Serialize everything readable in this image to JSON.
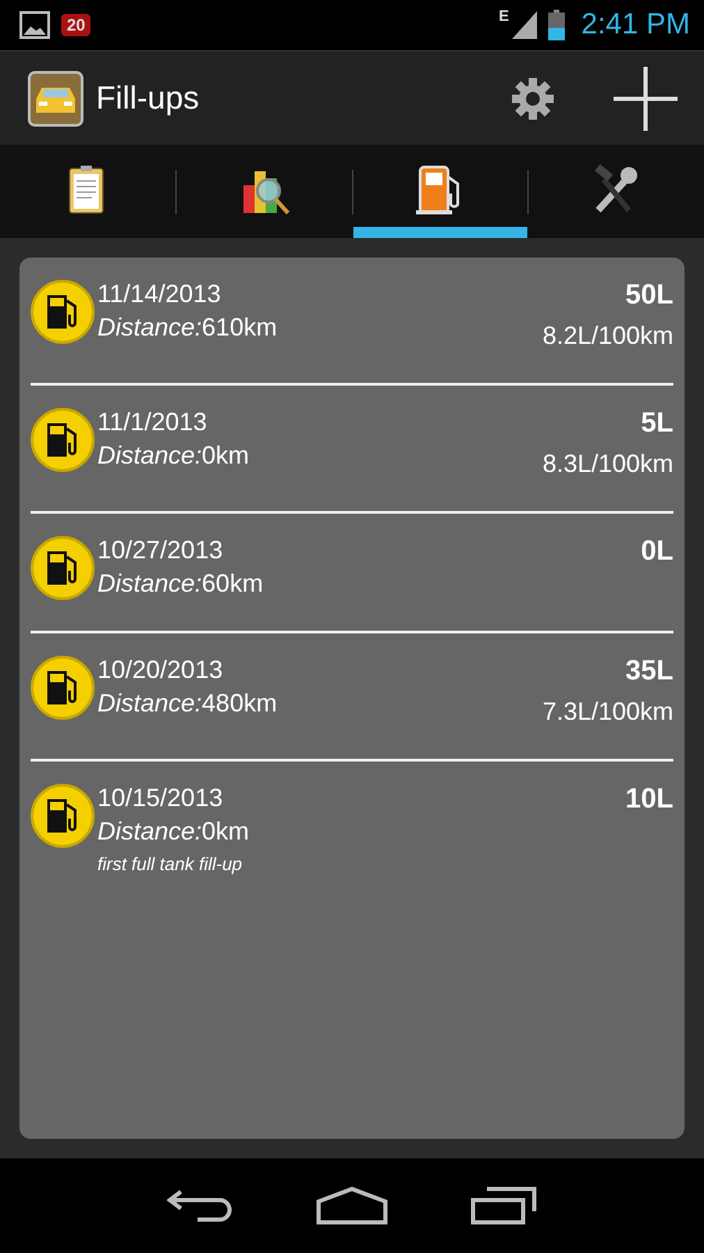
{
  "status_bar": {
    "badge": "20",
    "network": "E",
    "time": "2:41 PM"
  },
  "action_bar": {
    "title": "Fill-ups"
  },
  "tabs": [
    {
      "kind": "notes",
      "selected": false
    },
    {
      "kind": "stats",
      "selected": false
    },
    {
      "kind": "fuel",
      "selected": true
    },
    {
      "kind": "tools",
      "selected": false
    }
  ],
  "fillups": [
    {
      "date": "11/14/2013",
      "distance_label": "Distance:",
      "distance": "610km",
      "volume": "50L",
      "economy": "8.2L/100km"
    },
    {
      "date": "11/1/2013",
      "distance_label": "Distance:",
      "distance": "0km",
      "volume": "5L",
      "economy": "8.3L/100km"
    },
    {
      "date": "10/27/2013",
      "distance_label": "Distance:",
      "distance": "60km",
      "volume": "0L"
    },
    {
      "date": "10/20/2013",
      "distance_label": "Distance:",
      "distance": "480km",
      "volume": "35L",
      "economy": "7.3L/100km"
    },
    {
      "date": "10/15/2013",
      "distance_label": "Distance:",
      "distance": "0km",
      "volume": "10L",
      "note": "first full tank fill-up"
    }
  ]
}
